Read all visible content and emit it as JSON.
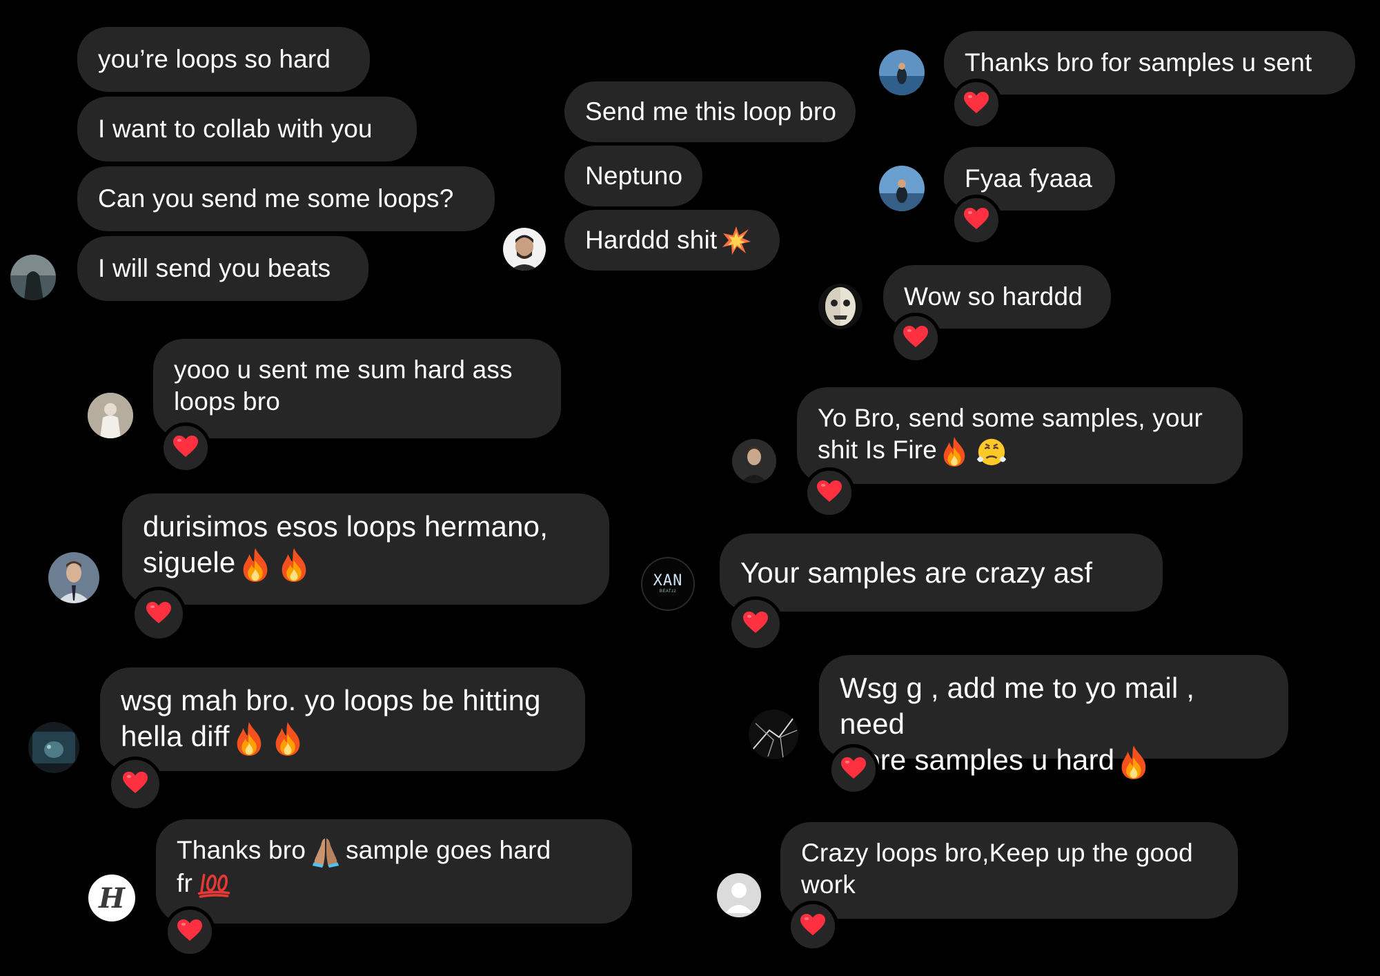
{
  "colors": {
    "background": "#000000",
    "bubble": "#262626",
    "heart": "#ff3040",
    "text": "#ffffff"
  },
  "messages": {
    "m1": "you’re loops so hard",
    "m2": "I want to collab with you",
    "m3": "Can you send me some loops?",
    "m4": "I will send you beats",
    "m5": "Send me this loop bro",
    "m6": "Neptuno",
    "m7": "Harddd shit",
    "m8": "Thanks bro for samples u sent",
    "m9": "Fyaa fyaaa",
    "m10": "Wow so harddd",
    "m11_l1": "yooo u sent me sum hard ass",
    "m11_l2": "loops bro",
    "m12_l1": "Yo Bro, send some samples, your",
    "m12_l2": "shit Is Fire",
    "m13_l1": "durisimos esos loops hermano,",
    "m13_l2": "siguele",
    "m14": "Your samples are crazy asf",
    "m15_l1": "wsg mah bro. yo loops be hitting",
    "m15_l2": "hella diff",
    "m16_l1": "Wsg g , add me to yo mail , need",
    "m16_l2": "more samples u hard",
    "m17_l1": "Thanks bro",
    "m17_mid": "sample goes hard",
    "m17_l2": "fr",
    "m18_l1": "Crazy loops bro,Keep up the good",
    "m18_l2": "work"
  },
  "avatars": {
    "xan_line1": "XAN",
    "xan_line2": "BEATzz",
    "h_letter": "H"
  },
  "icons": [
    "heart-icon",
    "fire-icon",
    "collision-icon",
    "pray-icon",
    "hundred-icon",
    "steam-face-icon",
    "default-avatar-icon"
  ]
}
